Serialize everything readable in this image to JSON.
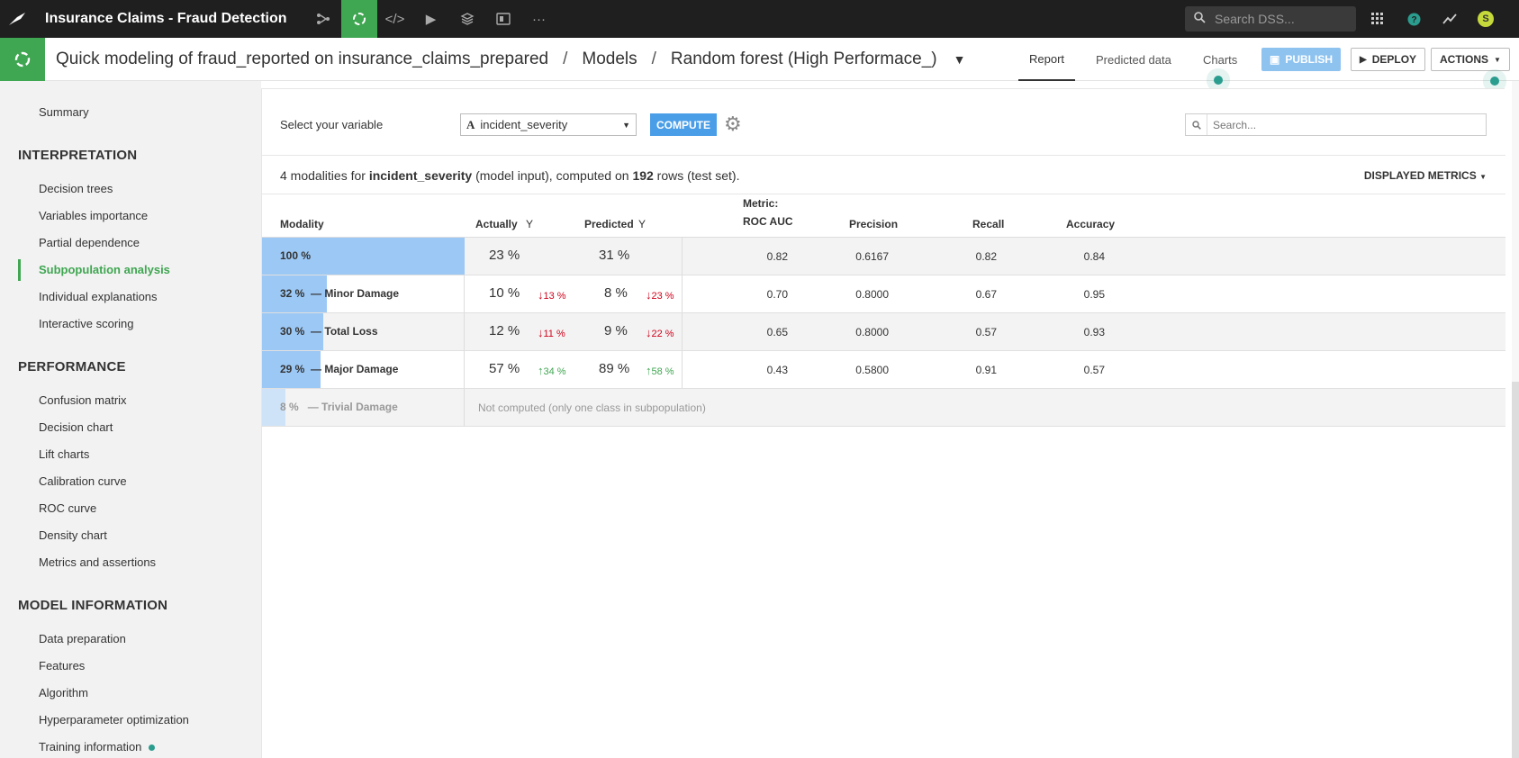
{
  "app": {
    "project_title": "Insurance Claims - Fraud Detection",
    "search_placeholder": "Search DSS...",
    "user_initial": "S"
  },
  "header": {
    "breadcrumb": [
      "Quick modeling of fraud_reported on insurance_claims_prepared",
      "Models",
      "Random forest (High Performace_)"
    ],
    "separator": "/",
    "tabs": [
      "Report",
      "Predicted data",
      "Charts"
    ],
    "active_tab": "Report",
    "publish_label": "PUBLISH",
    "deploy_label": "DEPLOY",
    "actions_label": "ACTIONS"
  },
  "sidebar": {
    "top_item": "Summary",
    "sections": [
      {
        "title": "INTERPRETATION",
        "items": [
          "Decision trees",
          "Variables importance",
          "Partial dependence",
          "Subpopulation analysis",
          "Individual explanations",
          "Interactive scoring"
        ]
      },
      {
        "title": "PERFORMANCE",
        "items": [
          "Confusion matrix",
          "Decision chart",
          "Lift charts",
          "Calibration curve",
          "ROC curve",
          "Density chart",
          "Metrics and assertions"
        ]
      },
      {
        "title": "MODEL INFORMATION",
        "items": [
          "Data preparation",
          "Features",
          "Algorithm",
          "Hyperparameter optimization",
          "Training information"
        ]
      }
    ],
    "active_item": "Subpopulation analysis"
  },
  "controls": {
    "variable_label": "Select your variable",
    "variable_type_icon": "A",
    "variable_value": "incident_severity",
    "compute_label": "COMPUTE",
    "search_placeholder": "Search..."
  },
  "summary": {
    "prefix": "4 modalities for ",
    "variable": "incident_severity",
    "middle": " (model input), computed on ",
    "rows": "192",
    "suffix": " rows (test set).",
    "displayed_metrics_label": "DISPLAYED METRICS"
  },
  "table": {
    "headers": {
      "modality": "Modality",
      "actually": "Actually",
      "predicted": "Predicted",
      "metric_line1": "Metric:",
      "metric_line2": "ROC AUC",
      "precision": "Precision",
      "recall": "Recall",
      "accuracy": "Accuracy",
      "filter_icon": "Y"
    },
    "rows": [
      {
        "share": "100 %",
        "share_value": 1.0,
        "name": "",
        "actually": "23 %",
        "actually_delta": "",
        "actually_dir": "",
        "predicted": "31 %",
        "predicted_delta": "",
        "predicted_dir": "",
        "roc_auc": "0.82",
        "precision": "0.6167",
        "recall": "0.82",
        "accuracy": "0.84"
      },
      {
        "share": "32 %",
        "share_value": 0.32,
        "name": "Minor Damage",
        "actually": "10 %",
        "actually_delta": "13 %",
        "actually_dir": "down",
        "predicted": "8 %",
        "predicted_delta": "23 %",
        "predicted_dir": "down",
        "roc_auc": "0.70",
        "precision": "0.8000",
        "recall": "0.67",
        "accuracy": "0.95"
      },
      {
        "share": "30 %",
        "share_value": 0.3,
        "name": "Total Loss",
        "actually": "12 %",
        "actually_delta": "11 %",
        "actually_dir": "down",
        "predicted": "9 %",
        "predicted_delta": "22 %",
        "predicted_dir": "down",
        "roc_auc": "0.65",
        "precision": "0.8000",
        "recall": "0.57",
        "accuracy": "0.93"
      },
      {
        "share": "29 %",
        "share_value": 0.29,
        "name": "Major Damage",
        "actually": "57 %",
        "actually_delta": "34 %",
        "actually_dir": "up",
        "predicted": "89 %",
        "predicted_delta": "58 %",
        "predicted_dir": "up",
        "roc_auc": "0.43",
        "precision": "0.5800",
        "recall": "0.91",
        "accuracy": "0.57"
      },
      {
        "share": "8 %",
        "share_value": 0.08,
        "name": "Trivial Damage",
        "not_computed": "Not computed (only one class in subpopulation)"
      }
    ],
    "dash": "—"
  },
  "icons": {
    "logo": "bird-logo-icon",
    "flow": "flow-icon",
    "ml": "ml-lab-icon",
    "code": "code-icon",
    "run": "play-icon",
    "db": "database-icon",
    "dashboard": "dashboard-icon",
    "more": "more-icon",
    "apps": "grid-icon",
    "help": "help-icon",
    "activity": "trend-icon"
  },
  "colors": {
    "accent_green": "#3fa651",
    "bar_blue": "#9cc8f5",
    "down_red": "#d0021b",
    "up_green": "#3fa651",
    "compute_blue": "#4a9ee8"
  }
}
